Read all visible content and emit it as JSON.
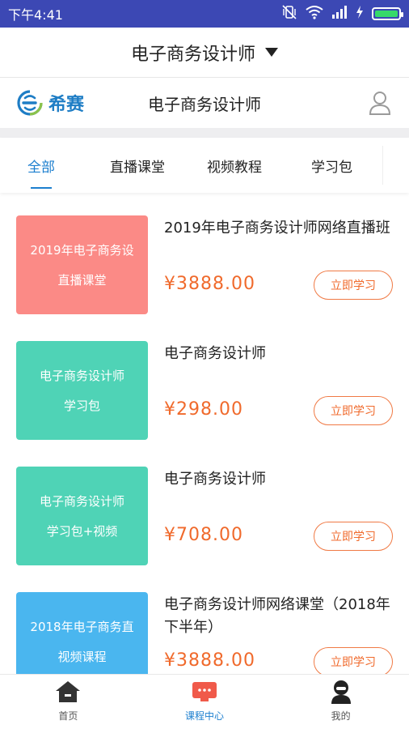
{
  "status_bar": {
    "time": "下午4:41",
    "battery_level": 1.0,
    "battery_color": "#36d96a"
  },
  "header": {
    "title": "电子商务设计师"
  },
  "brand": {
    "logo_text": "希赛",
    "page_title": "电子商务设计师"
  },
  "tabs": [
    {
      "label": "全部",
      "active": true
    },
    {
      "label": "直播课堂",
      "active": false
    },
    {
      "label": "视频教程",
      "active": false
    },
    {
      "label": "学习包",
      "active": false
    }
  ],
  "courses": [
    {
      "thumb_line1": "2019年电子商务设",
      "thumb_line2": "直播课堂",
      "title": "2019年电子商务设计师网络直播班",
      "price": "¥3888.00",
      "button": "立即学习",
      "thumb_color": "#fb8a86"
    },
    {
      "thumb_line1": "电子商务设计师",
      "thumb_line2": "学习包",
      "title": "电子商务设计师",
      "price": "¥298.00",
      "button": "立即学习",
      "thumb_color": "#4fd3b6"
    },
    {
      "thumb_line1": "电子商务设计师",
      "thumb_line2": "学习包+视频",
      "title": "电子商务设计师",
      "price": "¥708.00",
      "button": "立即学习",
      "thumb_color": "#4fd3b6"
    },
    {
      "thumb_line1": "2018年电子商务直",
      "thumb_line2": "视频课程",
      "title": "电子商务设计师网络课堂（2018年下半年）",
      "price": "¥3888.00",
      "button": "立即学习",
      "thumb_color": "#4ab6ef"
    }
  ],
  "bottom_nav": [
    {
      "label": "首页",
      "icon": "home-icon",
      "active": false
    },
    {
      "label": "课程中心",
      "icon": "course-center-icon",
      "active": true
    },
    {
      "label": "我的",
      "icon": "profile-icon",
      "active": false
    }
  ],
  "colors": {
    "accent": "#1c7fcf",
    "price": "#f06a2c",
    "status_bar": "#3c48b4"
  }
}
